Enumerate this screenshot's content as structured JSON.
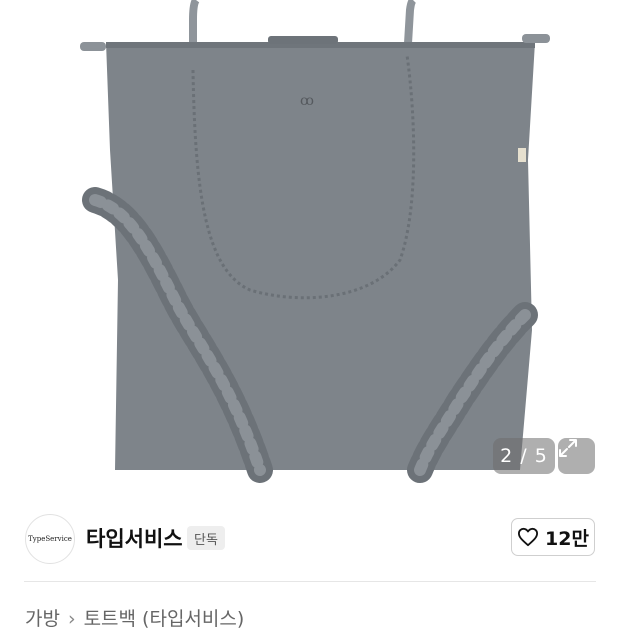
{
  "gallery": {
    "current": "2",
    "separator": "/",
    "total": "5",
    "counter_text": "2 / 5",
    "expand_icon": "expand-icon"
  },
  "brand": {
    "logo_text": "TypeService",
    "name": "타입서비스",
    "badge": "단독"
  },
  "like": {
    "icon": "heart-icon",
    "count": "12만"
  },
  "breadcrumb": {
    "items": [
      "가방",
      "토트백 (타입서비스)"
    ],
    "separator": "›"
  },
  "colors": {
    "bag": "#7e848a",
    "overlay": "#6e6e6e",
    "text": "#111111"
  }
}
